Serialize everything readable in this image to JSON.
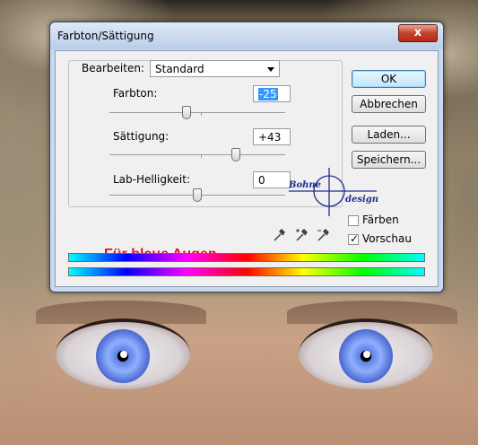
{
  "window": {
    "title": "Farbton/Sättigung",
    "close_glyph": "x"
  },
  "edit": {
    "label": "Bearbeiten:",
    "value": "Standard"
  },
  "sliders": [
    {
      "label": "Farbton:",
      "value": "-25",
      "level": 0.44
    },
    {
      "label": "Sättigung:",
      "value": "+43",
      "level": 0.72
    },
    {
      "label": "Lab-Helligkeit:",
      "value": "0",
      "level": 0.5
    }
  ],
  "buttons": {
    "ok": "OK",
    "cancel": "Abbrechen",
    "load": "Laden...",
    "save": "Speichern..."
  },
  "checkboxes": {
    "colorize": {
      "label": "Färben",
      "checked": false
    },
    "preview": {
      "label": "Vorschau",
      "checked": true
    }
  },
  "caption": "Für blaue Augen",
  "watermark": {
    "line1": "Bohne",
    "line2": "design"
  },
  "colors": {
    "caption": "#e0141b",
    "close_button": "#c4432c",
    "watermark": "#1f2f8f"
  },
  "icons": [
    "eyedropper-icon",
    "eyedropper-plus-icon",
    "eyedropper-minus-icon"
  ]
}
